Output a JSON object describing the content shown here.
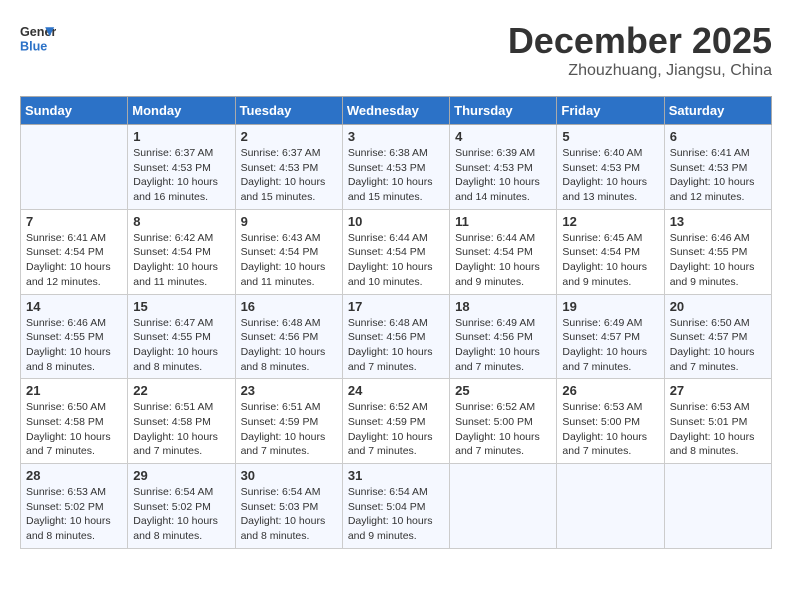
{
  "header": {
    "logo_line1": "General",
    "logo_line2": "Blue",
    "month_title": "December 2025",
    "location": "Zhouzhuang, Jiangsu, China"
  },
  "weekdays": [
    "Sunday",
    "Monday",
    "Tuesday",
    "Wednesday",
    "Thursday",
    "Friday",
    "Saturday"
  ],
  "weeks": [
    [
      {
        "day": "",
        "sunrise": "",
        "sunset": "",
        "daylight": ""
      },
      {
        "day": "1",
        "sunrise": "Sunrise: 6:37 AM",
        "sunset": "Sunset: 4:53 PM",
        "daylight": "Daylight: 10 hours and 16 minutes."
      },
      {
        "day": "2",
        "sunrise": "Sunrise: 6:37 AM",
        "sunset": "Sunset: 4:53 PM",
        "daylight": "Daylight: 10 hours and 15 minutes."
      },
      {
        "day": "3",
        "sunrise": "Sunrise: 6:38 AM",
        "sunset": "Sunset: 4:53 PM",
        "daylight": "Daylight: 10 hours and 15 minutes."
      },
      {
        "day": "4",
        "sunrise": "Sunrise: 6:39 AM",
        "sunset": "Sunset: 4:53 PM",
        "daylight": "Daylight: 10 hours and 14 minutes."
      },
      {
        "day": "5",
        "sunrise": "Sunrise: 6:40 AM",
        "sunset": "Sunset: 4:53 PM",
        "daylight": "Daylight: 10 hours and 13 minutes."
      },
      {
        "day": "6",
        "sunrise": "Sunrise: 6:41 AM",
        "sunset": "Sunset: 4:53 PM",
        "daylight": "Daylight: 10 hours and 12 minutes."
      }
    ],
    [
      {
        "day": "7",
        "sunrise": "Sunrise: 6:41 AM",
        "sunset": "Sunset: 4:54 PM",
        "daylight": "Daylight: 10 hours and 12 minutes."
      },
      {
        "day": "8",
        "sunrise": "Sunrise: 6:42 AM",
        "sunset": "Sunset: 4:54 PM",
        "daylight": "Daylight: 10 hours and 11 minutes."
      },
      {
        "day": "9",
        "sunrise": "Sunrise: 6:43 AM",
        "sunset": "Sunset: 4:54 PM",
        "daylight": "Daylight: 10 hours and 11 minutes."
      },
      {
        "day": "10",
        "sunrise": "Sunrise: 6:44 AM",
        "sunset": "Sunset: 4:54 PM",
        "daylight": "Daylight: 10 hours and 10 minutes."
      },
      {
        "day": "11",
        "sunrise": "Sunrise: 6:44 AM",
        "sunset": "Sunset: 4:54 PM",
        "daylight": "Daylight: 10 hours and 9 minutes."
      },
      {
        "day": "12",
        "sunrise": "Sunrise: 6:45 AM",
        "sunset": "Sunset: 4:54 PM",
        "daylight": "Daylight: 10 hours and 9 minutes."
      },
      {
        "day": "13",
        "sunrise": "Sunrise: 6:46 AM",
        "sunset": "Sunset: 4:55 PM",
        "daylight": "Daylight: 10 hours and 9 minutes."
      }
    ],
    [
      {
        "day": "14",
        "sunrise": "Sunrise: 6:46 AM",
        "sunset": "Sunset: 4:55 PM",
        "daylight": "Daylight: 10 hours and 8 minutes."
      },
      {
        "day": "15",
        "sunrise": "Sunrise: 6:47 AM",
        "sunset": "Sunset: 4:55 PM",
        "daylight": "Daylight: 10 hours and 8 minutes."
      },
      {
        "day": "16",
        "sunrise": "Sunrise: 6:48 AM",
        "sunset": "Sunset: 4:56 PM",
        "daylight": "Daylight: 10 hours and 8 minutes."
      },
      {
        "day": "17",
        "sunrise": "Sunrise: 6:48 AM",
        "sunset": "Sunset: 4:56 PM",
        "daylight": "Daylight: 10 hours and 7 minutes."
      },
      {
        "day": "18",
        "sunrise": "Sunrise: 6:49 AM",
        "sunset": "Sunset: 4:56 PM",
        "daylight": "Daylight: 10 hours and 7 minutes."
      },
      {
        "day": "19",
        "sunrise": "Sunrise: 6:49 AM",
        "sunset": "Sunset: 4:57 PM",
        "daylight": "Daylight: 10 hours and 7 minutes."
      },
      {
        "day": "20",
        "sunrise": "Sunrise: 6:50 AM",
        "sunset": "Sunset: 4:57 PM",
        "daylight": "Daylight: 10 hours and 7 minutes."
      }
    ],
    [
      {
        "day": "21",
        "sunrise": "Sunrise: 6:50 AM",
        "sunset": "Sunset: 4:58 PM",
        "daylight": "Daylight: 10 hours and 7 minutes."
      },
      {
        "day": "22",
        "sunrise": "Sunrise: 6:51 AM",
        "sunset": "Sunset: 4:58 PM",
        "daylight": "Daylight: 10 hours and 7 minutes."
      },
      {
        "day": "23",
        "sunrise": "Sunrise: 6:51 AM",
        "sunset": "Sunset: 4:59 PM",
        "daylight": "Daylight: 10 hours and 7 minutes."
      },
      {
        "day": "24",
        "sunrise": "Sunrise: 6:52 AM",
        "sunset": "Sunset: 4:59 PM",
        "daylight": "Daylight: 10 hours and 7 minutes."
      },
      {
        "day": "25",
        "sunrise": "Sunrise: 6:52 AM",
        "sunset": "Sunset: 5:00 PM",
        "daylight": "Daylight: 10 hours and 7 minutes."
      },
      {
        "day": "26",
        "sunrise": "Sunrise: 6:53 AM",
        "sunset": "Sunset: 5:00 PM",
        "daylight": "Daylight: 10 hours and 7 minutes."
      },
      {
        "day": "27",
        "sunrise": "Sunrise: 6:53 AM",
        "sunset": "Sunset: 5:01 PM",
        "daylight": "Daylight: 10 hours and 8 minutes."
      }
    ],
    [
      {
        "day": "28",
        "sunrise": "Sunrise: 6:53 AM",
        "sunset": "Sunset: 5:02 PM",
        "daylight": "Daylight: 10 hours and 8 minutes."
      },
      {
        "day": "29",
        "sunrise": "Sunrise: 6:54 AM",
        "sunset": "Sunset: 5:02 PM",
        "daylight": "Daylight: 10 hours and 8 minutes."
      },
      {
        "day": "30",
        "sunrise": "Sunrise: 6:54 AM",
        "sunset": "Sunset: 5:03 PM",
        "daylight": "Daylight: 10 hours and 8 minutes."
      },
      {
        "day": "31",
        "sunrise": "Sunrise: 6:54 AM",
        "sunset": "Sunset: 5:04 PM",
        "daylight": "Daylight: 10 hours and 9 minutes."
      },
      {
        "day": "",
        "sunrise": "",
        "sunset": "",
        "daylight": ""
      },
      {
        "day": "",
        "sunrise": "",
        "sunset": "",
        "daylight": ""
      },
      {
        "day": "",
        "sunrise": "",
        "sunset": "",
        "daylight": ""
      }
    ]
  ]
}
